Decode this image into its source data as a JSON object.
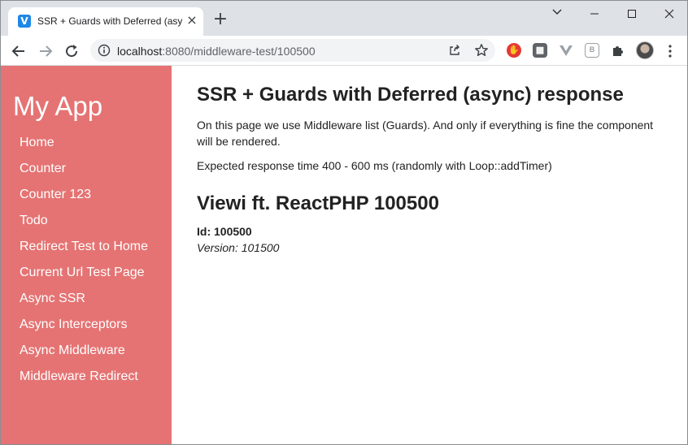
{
  "browser": {
    "tab_title": "SSR + Guards with Deferred (async) response",
    "tab_favicon_glyph": "V",
    "url_host": "localhost",
    "url_rest": ":8080/middleware-test/100500"
  },
  "icons": {
    "back": "arrow-left-icon",
    "forward": "arrow-right-icon",
    "reload": "reload-icon",
    "info": "info-icon",
    "share": "share-icon",
    "star": "star-icon",
    "menu": "kebab-menu-icon"
  },
  "colors": {
    "sidebar_bg": "#e57373",
    "accent_tab": "#1e88e5"
  },
  "sidebar": {
    "title": "My App",
    "items": [
      {
        "label": "Home"
      },
      {
        "label": "Counter"
      },
      {
        "label": "Counter 123"
      },
      {
        "label": "Todo"
      },
      {
        "label": "Redirect Test to Home"
      },
      {
        "label": "Current Url Test Page"
      },
      {
        "label": "Async SSR"
      },
      {
        "label": "Async Interceptors"
      },
      {
        "label": "Async Middleware"
      },
      {
        "label": "Middleware Redirect"
      }
    ]
  },
  "main": {
    "heading": "SSR + Guards with Deferred (async) response",
    "description": "On this page we use Middleware list (Guards). And only if everything is fine the component will be rendered.",
    "timing": "Expected response time 400 - 600 ms (randomly with Loop::addTimer)",
    "subheading": "Viewi ft. ReactPHP 100500",
    "id_text": "Id: 100500",
    "version_text": "Version: 101500"
  }
}
